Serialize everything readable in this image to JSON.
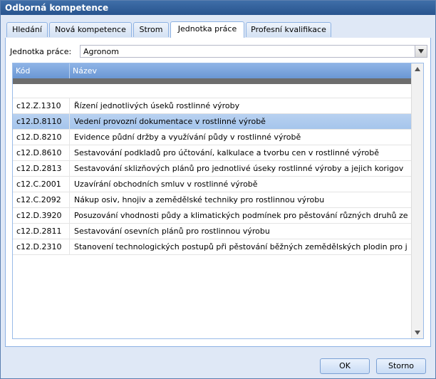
{
  "window": {
    "title": "Odborná kompetence"
  },
  "tabs": [
    "Hledání",
    "Nová kompetence",
    "Strom",
    "Jednotka práce",
    "Profesní kvalifikace"
  ],
  "active_tab": "Jednotka práce",
  "field": {
    "label": "Jednotka práce:",
    "value": "Agronom"
  },
  "grid": {
    "columns": [
      "Kód",
      "Název"
    ],
    "rows": [
      {
        "code": "c12.Z.1310",
        "name": "Řízení jednotlivých úseků rostlinné výroby"
      },
      {
        "code": "c12.D.8110",
        "name": "Vedení provozní dokumentace v rostlinné výrobě",
        "selected": true
      },
      {
        "code": "c12.D.8210",
        "name": "Evidence půdní držby a využívání půdy v rostlinné výrobě"
      },
      {
        "code": "c12.D.8610",
        "name": "Sestavování podkladů pro účtování, kalkulace a tvorbu cen v rostlinné výrobě"
      },
      {
        "code": "c12.D.2813",
        "name": "Sestavování sklizňových plánů pro jednotlivé úseky rostlinné výroby a jejich korigov"
      },
      {
        "code": "c12.C.2001",
        "name": "Uzavírání obchodních smluv v rostlinné výrobě"
      },
      {
        "code": "c12.C.2092",
        "name": "Nákup osiv, hnojiv a zemědělské techniky pro rostlinnou výrobu"
      },
      {
        "code": "c12.D.3920",
        "name": "Posuzování vhodnosti půdy a klimatických podmínek pro pěstování různých druhů ze"
      },
      {
        "code": "c12.D.2811",
        "name": "Sestavování osevních plánů pro rostlinnou výrobu"
      },
      {
        "code": "c12.D.2310",
        "name": "Stanovení technologických postupů při pěstování běžných zemědělských plodin pro j"
      }
    ]
  },
  "buttons": {
    "ok": "OK",
    "cancel": "Storno"
  },
  "colors": {
    "title_bar": "#28548e",
    "selected_row": "#a5c5ec",
    "header": "#6a97d4"
  }
}
